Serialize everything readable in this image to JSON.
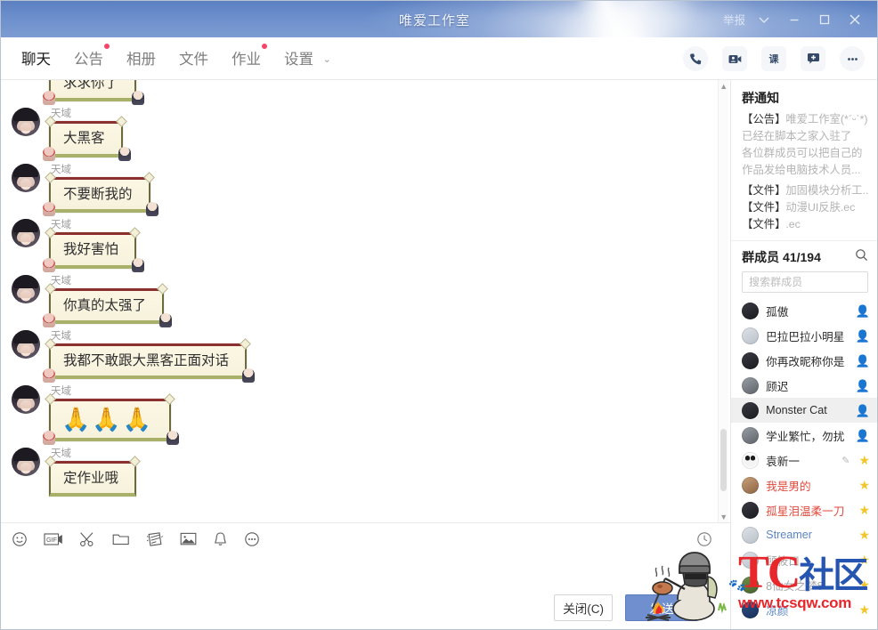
{
  "window": {
    "title": "唯爱工作室",
    "report_label": "举报",
    "chevron_icon": "chevron-down-icon",
    "minimize_icon": "minimize-icon",
    "maximize_icon": "maximize-icon",
    "close_icon": "close-icon"
  },
  "tabs": [
    {
      "label": "聊天",
      "active": true,
      "dot": false
    },
    {
      "label": "公告",
      "active": false,
      "dot": true
    },
    {
      "label": "相册",
      "active": false,
      "dot": false
    },
    {
      "label": "文件",
      "active": false,
      "dot": false
    },
    {
      "label": "作业",
      "active": false,
      "dot": true
    },
    {
      "label": "设置",
      "active": false,
      "dot": false,
      "chevron": true
    }
  ],
  "toolbar_icons": [
    {
      "name": "phone-call-icon"
    },
    {
      "name": "video-call-icon"
    },
    {
      "name": "class-lesson-icon",
      "glyph": "课"
    },
    {
      "name": "add-message-icon"
    },
    {
      "name": "more-options-icon"
    }
  ],
  "chat": {
    "messages": [
      {
        "sender": "",
        "text": "求求你了",
        "clipped": true,
        "emoji": false
      },
      {
        "sender": "天域",
        "text": "大黑客",
        "emoji": false
      },
      {
        "sender": "天域",
        "text": "不要断我的",
        "emoji": false
      },
      {
        "sender": "天域",
        "text": "我好害怕",
        "emoji": false
      },
      {
        "sender": "天域",
        "text": "你真的太强了",
        "emoji": false
      },
      {
        "sender": "天域",
        "text": "我都不敢跟大黑客正面对话",
        "emoji": false
      },
      {
        "sender": "天域",
        "text": "🙏🙏🙏",
        "emoji": true
      },
      {
        "sender": "天域",
        "text": "定作业哦",
        "emoji": false,
        "cut": true
      }
    ]
  },
  "input_toolbar": {
    "icons": [
      {
        "name": "emoji-icon"
      },
      {
        "name": "gif-icon",
        "glyph": "GIF"
      },
      {
        "name": "screenshot-scissors-icon"
      },
      {
        "name": "folder-file-icon"
      },
      {
        "name": "shake-window-icon"
      },
      {
        "name": "image-picture-icon"
      },
      {
        "name": "bell-reminder-icon"
      },
      {
        "name": "more-tools-icon"
      }
    ],
    "history_icon": "clock-history-icon"
  },
  "footer": {
    "close_label": "关闭(C)",
    "send_label": "发送"
  },
  "notice": {
    "title": "群通知",
    "lines": [
      {
        "tag": "【公告】",
        "text": "唯爱工作室(*ˊᵕˋ*)"
      },
      {
        "tag": "",
        "text": "已经在脚本之家入驻了"
      },
      {
        "tag": "",
        "text": "各位群成员可以把自己的"
      },
      {
        "tag": "",
        "text": "作品发给电脑技术人员..."
      },
      {
        "tag": "【文件】",
        "text": "加固模块分析工..."
      },
      {
        "tag": "【文件】",
        "text": "动漫UI反肤.ec"
      },
      {
        "tag": "【文件】",
        "text": ".ec"
      }
    ]
  },
  "members": {
    "title": "群成员 41/194",
    "search_icon": "search-icon",
    "search_placeholder": "搜索群成员",
    "search_value": "",
    "list": [
      {
        "name": "孤傲",
        "avatar": "dark",
        "badge": "admin",
        "color": "",
        "selected": false
      },
      {
        "name": "巴拉巴拉小明星",
        "avatar": "light",
        "badge": "admin",
        "color": "",
        "selected": false
      },
      {
        "name": "你再改昵称你是",
        "avatar": "dark",
        "badge": "admin",
        "color": "",
        "selected": false
      },
      {
        "name": "顾迟",
        "avatar": "gray",
        "badge": "admin",
        "color": "",
        "selected": false
      },
      {
        "name": "Monster Cat",
        "avatar": "dark",
        "badge": "admin",
        "color": "",
        "selected": true
      },
      {
        "name": "学业繁忙，勿扰",
        "avatar": "gray",
        "badge": "admin",
        "color": "",
        "selected": false
      },
      {
        "name": "袁新一",
        "avatar": "panda",
        "badge": "star",
        "color": "",
        "pencil": true,
        "selected": false
      },
      {
        "name": "我是男的",
        "avatar": "warm",
        "badge": "star",
        "color": "red",
        "selected": false
      },
      {
        "name": "孤星泪温柔一刀",
        "avatar": "dark",
        "badge": "star",
        "color": "red",
        "selected": false
      },
      {
        "name": "Streamer",
        "avatar": "light",
        "badge": "star",
        "color": "blue",
        "selected": false
      },
      {
        "name": "顾筱口",
        "avatar": "light",
        "badge": "star",
        "color": "gray",
        "selected": false
      },
      {
        "name": "8仙女之梦8",
        "avatar": "green",
        "badge": "star",
        "color": "gray",
        "selected": false
      },
      {
        "name": "凉颜",
        "avatar": "blue",
        "badge": "star",
        "color": "blue",
        "selected": false
      }
    ]
  },
  "watermark": {
    "t": "T",
    "c": "C",
    "community": "社区",
    "url": "www.tcsqw.com",
    "sticker_icon": "pubg-campfire-sticker"
  },
  "colors": {
    "titlebar_accent": "#6b8ecb",
    "tab_active": "#1b1b1b",
    "dot_red": "#f5456b",
    "send_button": "#6f8fce",
    "bubble_bg": "#fbf7e4",
    "bubble_top": "#8b2f2f",
    "bubble_bottom": "#a8b06a",
    "selected_row": "#efefef",
    "watermark_red": "#e8272c",
    "watermark_blue": "#2555b0"
  }
}
